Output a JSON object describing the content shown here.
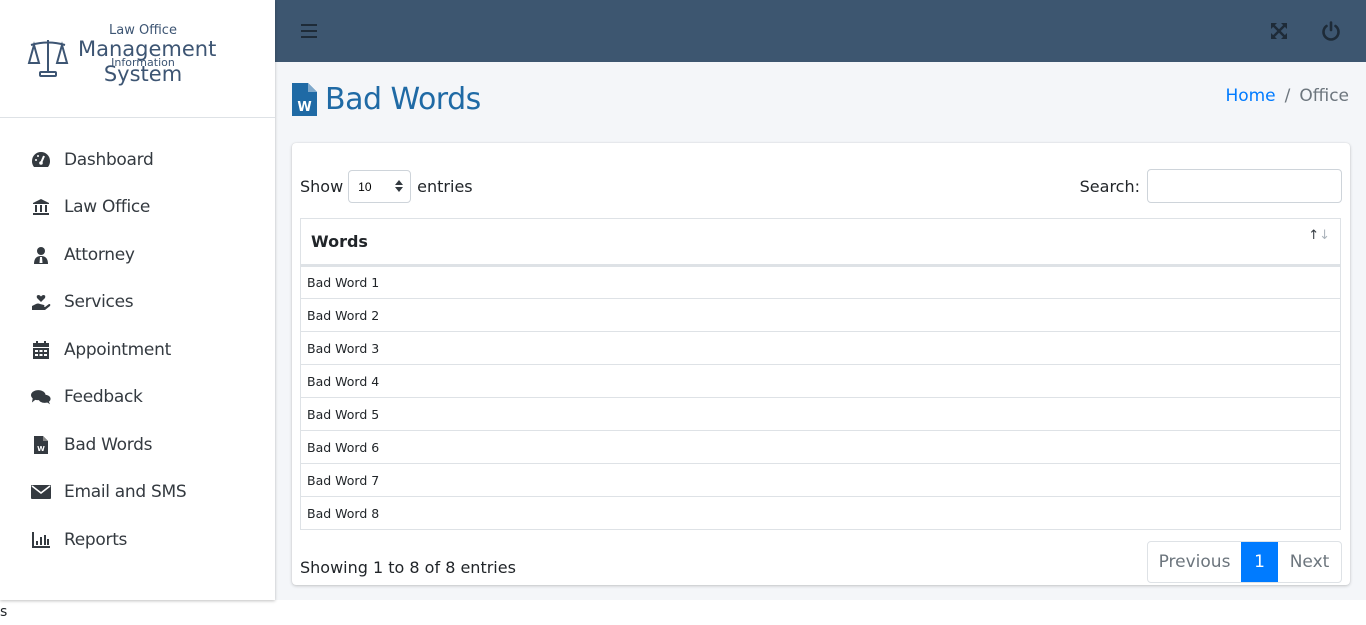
{
  "logo": {
    "line1": "Law Office",
    "line2": "Management",
    "line3": "Information",
    "line4": "System",
    "icon": "scales-icon"
  },
  "sidebar": {
    "items": [
      {
        "label": "Dashboard",
        "icon": "tachometer-icon"
      },
      {
        "label": "Law Office",
        "icon": "landmark-icon"
      },
      {
        "label": "Attorney",
        "icon": "user-tie-icon"
      },
      {
        "label": "Services",
        "icon": "hand-holding-heart-icon"
      },
      {
        "label": "Appointment",
        "icon": "calendar-icon"
      },
      {
        "label": "Feedback",
        "icon": "comments-icon"
      },
      {
        "label": "Bad Words",
        "icon": "file-word-icon"
      },
      {
        "label": "Email and SMS",
        "icon": "envelope-icon"
      },
      {
        "label": "Reports",
        "icon": "chart-bar-icon"
      }
    ]
  },
  "topbar": {
    "menu_icon": "hamburger-icon",
    "fullscreen_icon": "expand-arrows-icon",
    "logout_icon": "power-icon"
  },
  "page": {
    "title": "Bad Words",
    "title_icon": "file-word-icon",
    "breadcrumb": {
      "home": "Home",
      "separator": "/",
      "current": "Office"
    }
  },
  "table_controls": {
    "show_label": "Show",
    "entries_label": "entries",
    "page_length": "10",
    "search_label": "Search:",
    "search_value": "",
    "search_placeholder": ""
  },
  "table": {
    "columns": [
      "Words"
    ],
    "rows": [
      "Bad Word 1",
      "Bad Word 2",
      "Bad Word 3",
      "Bad Word 4",
      "Bad Word 5",
      "Bad Word 6",
      "Bad Word 7",
      "Bad Word 8"
    ]
  },
  "footer": {
    "info": "Showing 1 to 8 of 8 entries",
    "prev_label": "Previous",
    "current_page": "1",
    "next_label": "Next"
  },
  "colors": {
    "topbar": "#3d5670",
    "accent": "#007bff",
    "title": "#1f6aa5"
  },
  "stray_text": "s"
}
